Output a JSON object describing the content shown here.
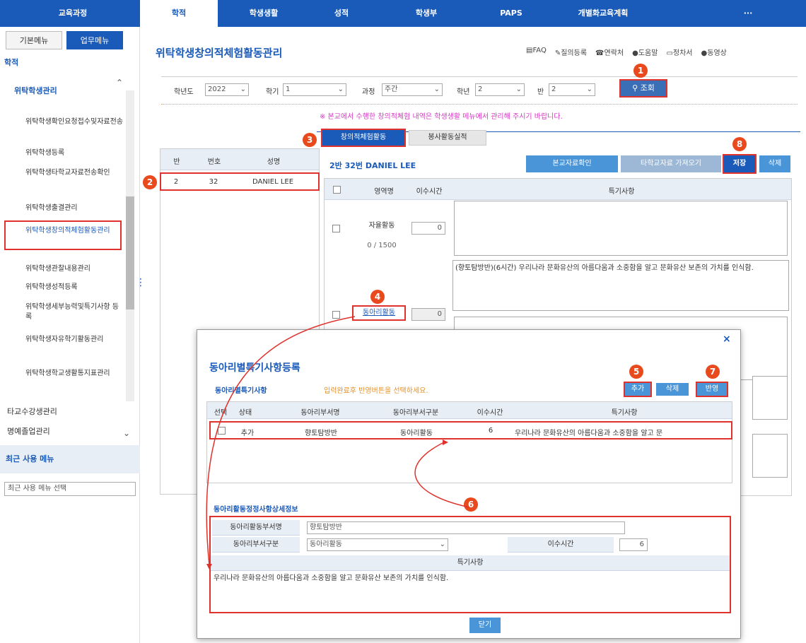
{
  "topnav": {
    "items": [
      "교육과정",
      "학적",
      "학생생활",
      "성적",
      "학생부",
      "PAPS",
      "개별화교육계획",
      "···"
    ],
    "active": 1
  },
  "sidebar": {
    "tabs": [
      "기본메뉴",
      "업무메뉴"
    ],
    "section": "학적",
    "group": "위탁학생관리",
    "items": [
      "위탁학생확인요청접수및자료전송",
      "위탁학생등록",
      "위탁학생타학교자료전송확인",
      "위탁학생출결관리",
      "위탁학생창의적체험활동관리",
      "위탁학생관찰내용관리",
      "위탁학생성적등록",
      "위탁학생세부능력및특기사항 등록",
      "위탁학생자유학기활동관리",
      "위탁학생학교생활통지표관리"
    ],
    "other_groups": [
      "타교수강생관리",
      "명예졸업관리"
    ],
    "recent_title": "최근 사용 메뉴",
    "recent_select": "최근 사용 메뉴 선택"
  },
  "page": {
    "title": "위탁학생창의적체험활동관리",
    "links": [
      "FAQ",
      "질의등록",
      "연락처",
      "도움말",
      "정차서",
      "동영상"
    ]
  },
  "filters": {
    "year_label": "학년도",
    "year": "2022",
    "term_label": "학기",
    "term": "1",
    "course_label": "과정",
    "course": "주간",
    "grade_label": "학년",
    "grade": "2",
    "class_label": "반",
    "class": "2",
    "search_btn": "조회"
  },
  "notice": "※ 본교에서 수행한 창의적체험 내역은 학생생활 메뉴에서 관리해 주시기 바랍니다.",
  "tabs": [
    "창의적체험활동",
    "봉사활동실적"
  ],
  "student_table": {
    "headers": [
      "반",
      "번호",
      "성명"
    ],
    "rows": [
      [
        "2",
        "32",
        "DANIEL LEE"
      ]
    ]
  },
  "detail": {
    "student": "2반 32번 DANIEL LEE",
    "buttons": [
      "본교자료확인",
      "타학교자료 가져오기",
      "저장",
      "삭제"
    ],
    "headers": [
      "영역명",
      "이수시간",
      "특기사항"
    ],
    "rows": [
      {
        "name": "자율활동",
        "hours": "0",
        "count": "0 / 1500",
        "note": ""
      },
      {
        "name": "동아리활동",
        "hours": "0",
        "note": "(향토탐방반)(6시간) 우리나라 문화유산의 아름다움과 소중함을 알고 문화유산 보존의 가치를 인식함."
      }
    ]
  },
  "modal": {
    "title": "동아리별특기사항등록",
    "close": "×",
    "section": "동아리별특기사항",
    "hint": "입력완료후 반영버튼을 선택하세요.",
    "buttons": [
      "추가",
      "삭제",
      "반영"
    ],
    "headers": [
      "선택",
      "상태",
      "동아리부서명",
      "동아리부서구분",
      "이수시간",
      "특기사항"
    ],
    "rows": [
      [
        "추가",
        "향토탐방반",
        "동아리활동",
        "6",
        "우리나라 문화유산의 아름다움과 소중함을 알고 문"
      ]
    ],
    "detail_title": "동아리활동정정사항상세정보",
    "f_name_label": "동아리활동부서명",
    "f_name": "향토탐방반",
    "f_type_label": "동아리부서구분",
    "f_type": "동아리활동",
    "f_hours_label": "이수시간",
    "f_hours": "6",
    "f_note_label": "특기사항",
    "f_note": "우리나라 문화유산의 아름다움과 소중함을 알고 문화유산 보존의 가치를 인식함.",
    "close_btn": "닫기"
  },
  "badges": [
    "1",
    "2",
    "3",
    "4",
    "5",
    "6",
    "7",
    "8"
  ],
  "colors": {
    "nav": "#1a5ab8",
    "accent": "#e0322c",
    "badge": "#e8491d",
    "button": "#4a95d8"
  }
}
